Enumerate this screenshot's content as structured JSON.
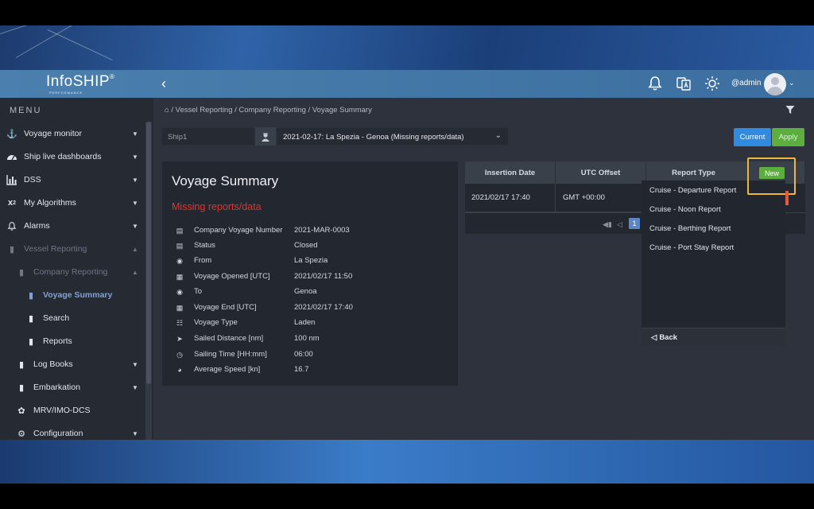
{
  "header": {
    "logo_main": "InfoSHIP",
    "logo_reg": "®",
    "logo_sub": "PERFORMANCE",
    "user": "@admin"
  },
  "sidebar": {
    "menu_title": "MENU",
    "items": [
      {
        "label": "Voyage monitor",
        "icon": "anchor-icon"
      },
      {
        "label": "Ship live dashboards",
        "icon": "dashboard-icon"
      },
      {
        "label": "DSS",
        "icon": "bar-chart-icon"
      },
      {
        "label": "My Algorithms",
        "icon": "x-squared-icon"
      },
      {
        "label": "Alarms",
        "icon": "bell-icon"
      },
      {
        "label": "Vessel Reporting",
        "icon": "book-icon"
      },
      {
        "label": "Company Reporting",
        "icon": "book-icon"
      },
      {
        "label": "Voyage Summary",
        "icon": "book-icon"
      },
      {
        "label": "Search",
        "icon": "book-icon"
      },
      {
        "label": "Reports",
        "icon": "book-icon"
      },
      {
        "label": "Log Books",
        "icon": "book-icon"
      },
      {
        "label": "Embarkation",
        "icon": "book-icon"
      },
      {
        "label": "MRV/IMO-DCS",
        "icon": "leaf-icon"
      },
      {
        "label": "Configuration",
        "icon": "gears-icon"
      }
    ]
  },
  "breadcrumb": {
    "separator": "/",
    "items": [
      "Vessel Reporting",
      "Company Reporting",
      "Voyage Summary"
    ]
  },
  "filters": {
    "ship_placeholder": "Ship1",
    "voyage_value": "2021-02-17: La Spezia - Genoa (Missing reports/data)",
    "current_label": "Current",
    "apply_label": "Apply"
  },
  "summary": {
    "title": "Voyage Summary",
    "warning": "Missing reports/data",
    "rows": [
      {
        "label": "Company Voyage Number",
        "value": "2021-MAR-0003",
        "icon": "id-card-icon"
      },
      {
        "label": "Status",
        "value": "Closed",
        "icon": "id-card-icon"
      },
      {
        "label": "From",
        "value": "La Spezia",
        "icon": "map-marker-icon"
      },
      {
        "label": "Voyage Opened [UTC]",
        "value": "2021/02/17 11:50",
        "icon": "calendar-icon"
      },
      {
        "label": "To",
        "value": "Genoa",
        "icon": "map-marker-icon"
      },
      {
        "label": "Voyage End [UTC]",
        "value": "2021/02/17 17:40",
        "icon": "calendar-icon"
      },
      {
        "label": "Voyage Type",
        "value": "Laden",
        "icon": "database-icon"
      },
      {
        "label": "Sailed Distance [nm]",
        "value": "100 nm",
        "icon": "cursor-icon"
      },
      {
        "label": "Sailing Time [HH:mm]",
        "value": "06:00",
        "icon": "clock-icon"
      },
      {
        "label": "Average Speed [kn]",
        "value": "16.7",
        "icon": "speedometer-icon"
      }
    ]
  },
  "reports_table": {
    "columns": [
      "Insertion Date",
      "UTC Offset",
      "Report Type"
    ],
    "rows": [
      {
        "insertion_date": "2021/02/17 17:40",
        "utc_offset": "GMT +00:00"
      }
    ],
    "page": "1",
    "new_label": "New"
  },
  "report_type_menu": {
    "items": [
      "Cruise - Departure Report",
      "Cruise - Noon Report",
      "Cruise - Berthing Report",
      "Cruise - Port Stay Report"
    ],
    "back_label": "Back"
  },
  "colors": {
    "header": "#4a7fae",
    "sidebar": "#252a33",
    "main": "#2d323c",
    "warning": "#e0342e",
    "primary": "#2f8ae0",
    "success": "#5cae3f",
    "highlight": "#f0b63a"
  }
}
